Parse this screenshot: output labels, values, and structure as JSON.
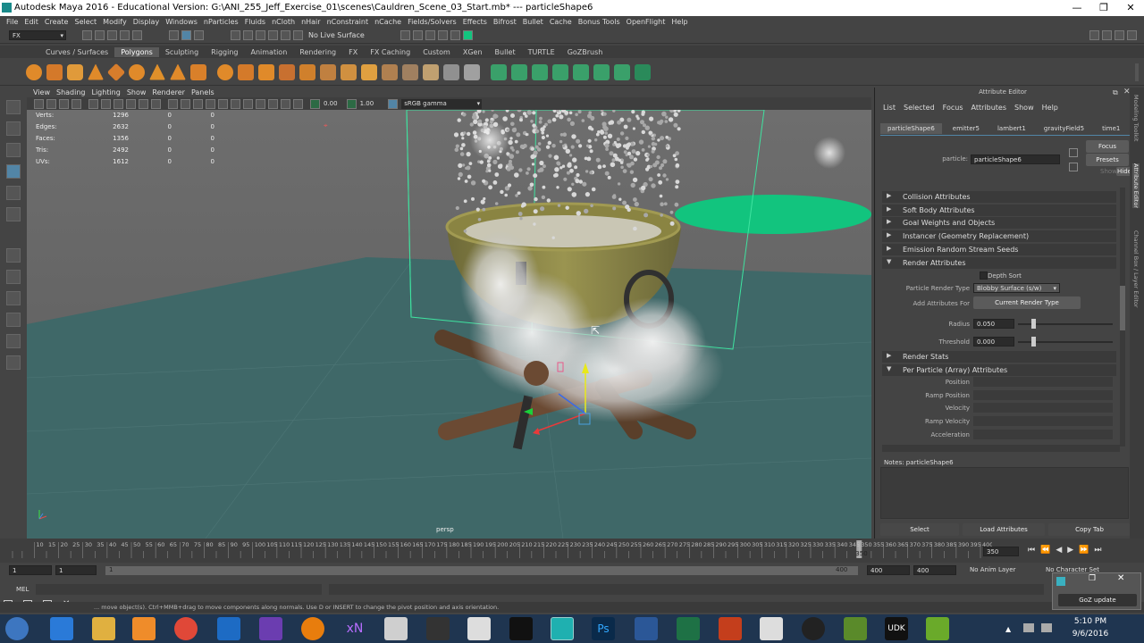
{
  "window": {
    "title": "Autodesk Maya 2016 - Educational Version: G:\\ANI_255_Jeff_Exercise_01\\scenes\\Cauldren_Scene_03_Start.mb*  ---  particleShape6",
    "minimize": "—",
    "maximize": "❐",
    "close": "✕"
  },
  "menus": [
    "File",
    "Edit",
    "Create",
    "Select",
    "Modify",
    "Display",
    "Windows",
    "nParticles",
    "Fluids",
    "nCloth",
    "nHair",
    "nConstraint",
    "nCache",
    "Fields/Solvers",
    "Effects",
    "Bifrost",
    "Bullet",
    "Cache",
    "Bonus Tools",
    "OpenFlight",
    "Help"
  ],
  "status_line": {
    "menuset": "FX",
    "live_surface": "No Live Surface"
  },
  "shelf_tabs": [
    "Curves / Surfaces",
    "Polygons",
    "Sculpting",
    "Rigging",
    "Animation",
    "Rendering",
    "FX",
    "FX Caching",
    "Custom",
    "XGen",
    "Bullet",
    "TURTLE",
    "GoZBrush"
  ],
  "active_shelf": "Polygons",
  "viewport": {
    "menus": [
      "View",
      "Shading",
      "Lighting",
      "Show",
      "Renderer",
      "Panels"
    ],
    "exposure": "0.00",
    "gamma": "1.00",
    "color_space": "sRGB gamma",
    "camera": "persp",
    "hud": [
      {
        "label": "Verts:",
        "v1": "1296",
        "v2": "0",
        "v3": "0"
      },
      {
        "label": "Edges:",
        "v1": "2632",
        "v2": "0",
        "v3": "0"
      },
      {
        "label": "Faces:",
        "v1": "1356",
        "v2": "0",
        "v3": "0"
      },
      {
        "label": "Tris:",
        "v1": "2492",
        "v2": "0",
        "v3": "0"
      },
      {
        "label": "UVs:",
        "v1": "1612",
        "v2": "0",
        "v3": "0"
      }
    ]
  },
  "attribute_editor": {
    "title": "Attribute Editor",
    "menus": [
      "List",
      "Selected",
      "Focus",
      "Attributes",
      "Show",
      "Help"
    ],
    "tabs": [
      "particleShape6",
      "emitter5",
      "lambert1",
      "gravityField5",
      "time1"
    ],
    "active_tab": "particleShape6",
    "node_label": "particle:",
    "node_value": "particleShape6",
    "focus": "Focus",
    "presets": "Presets",
    "show": "Show",
    "hide": "Hide",
    "sections_top": [
      "Collision Attributes",
      "Soft Body Attributes",
      "Goal Weights and Objects",
      "Instancer (Geometry Replacement)",
      "Emission Random Stream Seeds",
      "Render Attributes"
    ],
    "depth_sort": "Depth Sort",
    "render_type_label": "Particle Render Type",
    "render_type_value": "Blobby Surface (s/w)",
    "add_attrs_label": "Add Attributes For",
    "add_attrs_button": "Current Render Type",
    "radius_label": "Radius",
    "radius_value": "0.050",
    "radius_fraction": 0.33,
    "threshold_label": "Threshold",
    "threshold_value": "0.000",
    "threshold_fraction": 0.33,
    "render_stats": "Render Stats",
    "per_particle": "Per Particle (Array) Attributes",
    "pp_rows": [
      "Position",
      "Ramp Position",
      "Velocity",
      "Ramp Velocity",
      "Acceleration"
    ],
    "notes": "Notes:  particleShape6",
    "bottom_buttons": [
      "Select",
      "Load Attributes",
      "Copy Tab"
    ]
  },
  "side_tabs": [
    "Modeling Toolkit",
    "Attribute Editor",
    "Channel Box / Layer Editor"
  ],
  "timeline": {
    "ticks": [
      "10",
      "15",
      "20",
      "25",
      "30",
      "35",
      "40",
      "45",
      "50",
      "55",
      "60",
      "65",
      "70",
      "75",
      "80",
      "85",
      "90",
      "95",
      "100",
      "105",
      "110",
      "115",
      "120",
      "125",
      "130",
      "135",
      "140",
      "145",
      "150",
      "155",
      "160",
      "165",
      "170",
      "175",
      "180",
      "185",
      "190",
      "195",
      "200",
      "205",
      "210",
      "215",
      "220",
      "225",
      "230",
      "235",
      "240",
      "245",
      "250",
      "255",
      "260",
      "265",
      "270",
      "275",
      "280",
      "285",
      "290",
      "295",
      "300",
      "305",
      "310",
      "315",
      "320",
      "325",
      "330",
      "335",
      "340",
      "345",
      "350",
      "355",
      "360",
      "365",
      "370",
      "375",
      "380",
      "385",
      "390",
      "395",
      "400"
    ],
    "current_frame": "350",
    "current_field": "350",
    "range_start": "1",
    "range_start2": "1",
    "range_handle": "1",
    "range_end_handle": "400",
    "range_end": "400",
    "range_end2": "400",
    "anim_layer": "No Anim Layer",
    "char_set": "No Character Set"
  },
  "command_line": {
    "lang": "MEL"
  },
  "help_line": "... move object(s). Ctrl+MMB+drag to move components along normals. Use D or INSERT to change the pivot position and axis orientation.",
  "goz_update": "GoZ update",
  "taskbar": {
    "time": "5:10 PM",
    "date": "9/6/2016"
  },
  "colors": {
    "accent": "#5285a6",
    "emitter_disc": "#12c47e",
    "bounding_box": "#3fe3a0",
    "cauldron": "#8a8442"
  }
}
